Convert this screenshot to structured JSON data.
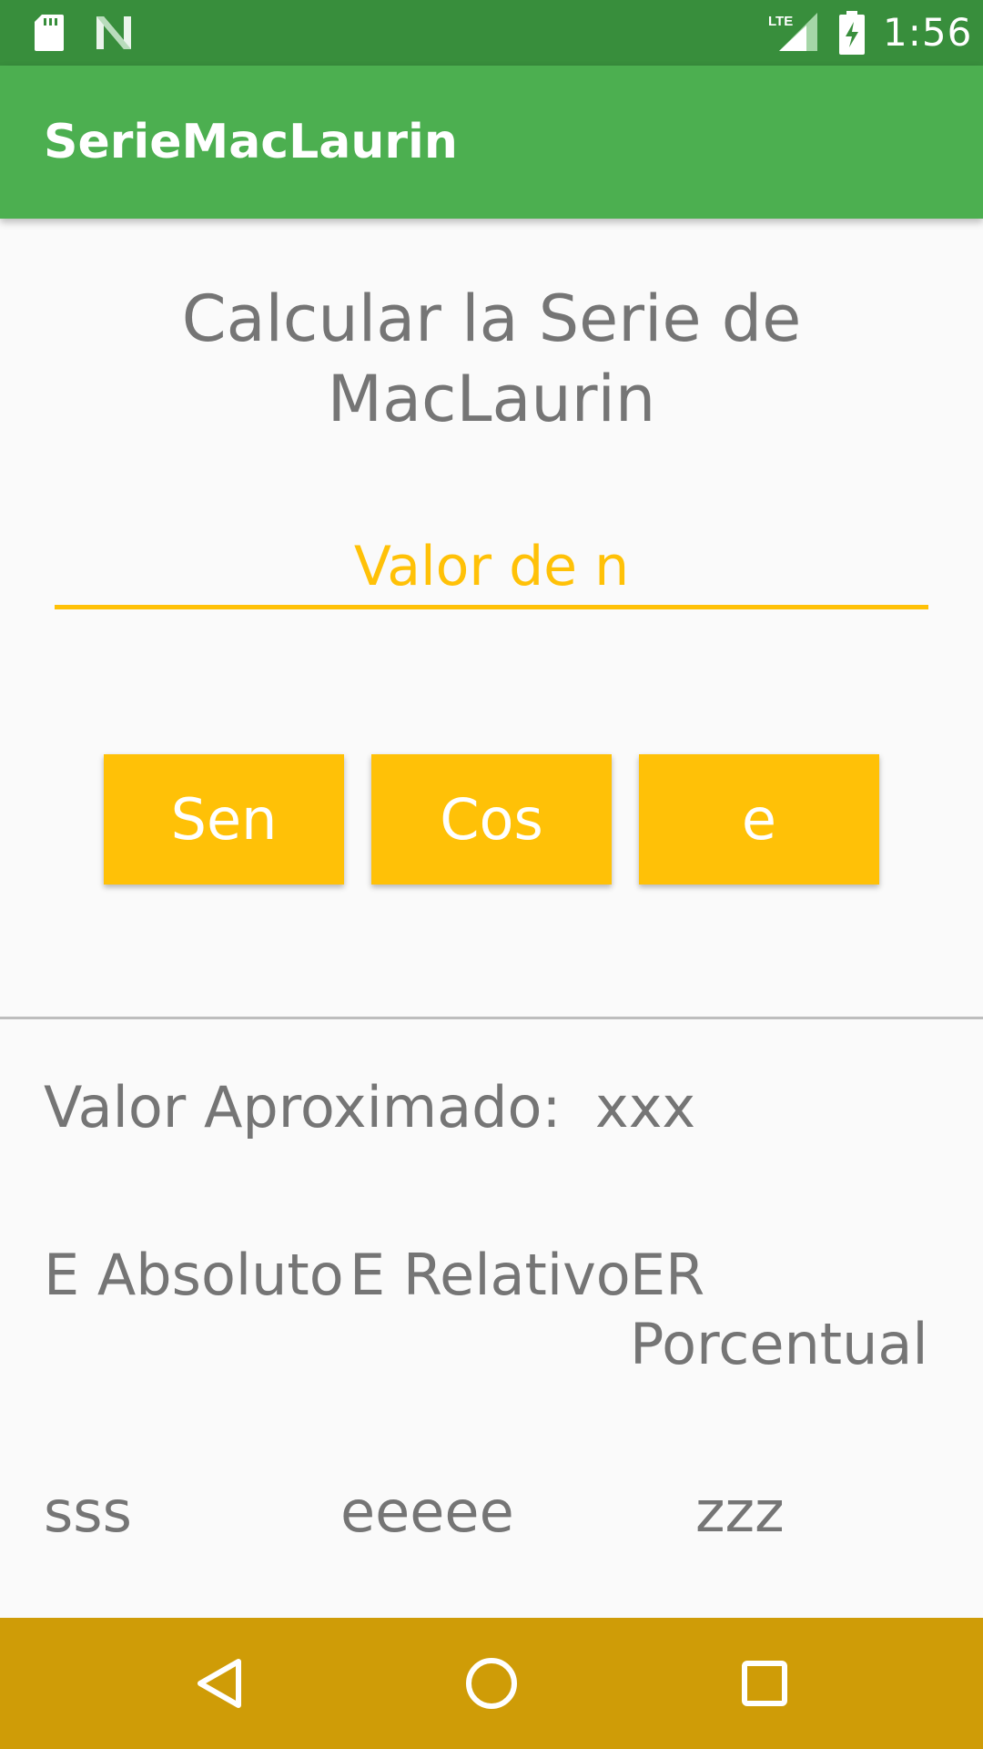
{
  "status_bar": {
    "time": "1:56",
    "icons": [
      "sd-card-icon",
      "n-logo-icon",
      "lte-signal-icon",
      "battery-charging-icon"
    ]
  },
  "app_bar": {
    "title": "SerieMacLaurin"
  },
  "main": {
    "heading": "Calcular la Serie de MacLaurin",
    "input_placeholder": "Valor de n",
    "buttons": {
      "sen": "Sen",
      "cos": "Cos",
      "e": "e"
    },
    "approx_label": "Valor Aproximado:",
    "approx_value": "xxx",
    "error_labels": {
      "absolute": "E Absoluto",
      "relative": "E Relativo",
      "percent": "ER Porcentual"
    },
    "error_values": {
      "absolute": "sss",
      "relative": "eeeee",
      "percent": "zzz"
    }
  },
  "nav_bar": {
    "icons": [
      "back-icon",
      "home-icon",
      "recents-icon"
    ]
  },
  "colors": {
    "status_bar": "#388e3c",
    "app_bar": "#4caf50",
    "accent": "#ffc107",
    "nav_bar": "#cf9c07",
    "text_secondary": "#757575"
  }
}
